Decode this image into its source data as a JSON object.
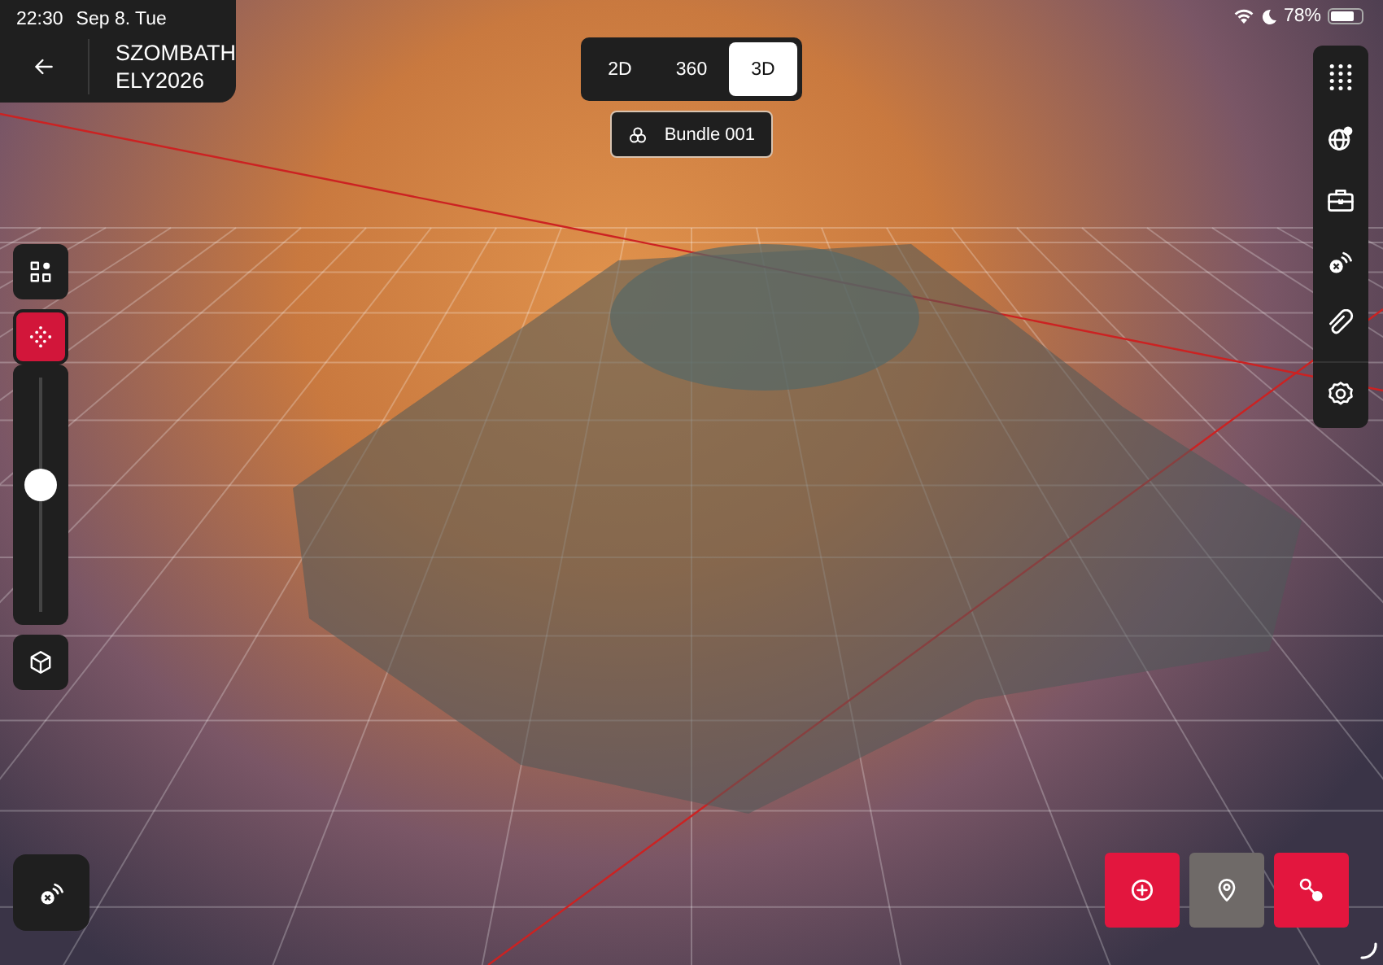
{
  "status_bar": {
    "time": "22:30",
    "date": "Sep 8. Tue",
    "battery": "78%"
  },
  "header": {
    "title_lines": [
      "SZOMBATH",
      "ELY2026"
    ]
  },
  "view_modes": [
    {
      "label": "2D",
      "selected": false
    },
    {
      "label": "360",
      "selected": false
    },
    {
      "label": "3D",
      "selected": true
    }
  ],
  "bundle": {
    "label": "Bundle 001"
  },
  "left_tools": [
    {
      "kind": "layout",
      "selected": false
    },
    {
      "kind": "points",
      "selected": true
    }
  ],
  "point_size_slider": {
    "level": 0.54
  },
  "right_tools": [
    {
      "kind": "grid"
    },
    {
      "kind": "globe"
    },
    {
      "kind": "toolbox"
    },
    {
      "kind": "signal"
    },
    {
      "kind": "link"
    },
    {
      "kind": "settings"
    }
  ],
  "action_buttons": [
    {
      "kind": "add",
      "enabled": true
    },
    {
      "kind": "pin",
      "enabled": false
    },
    {
      "kind": "measure",
      "enabled": true
    }
  ]
}
